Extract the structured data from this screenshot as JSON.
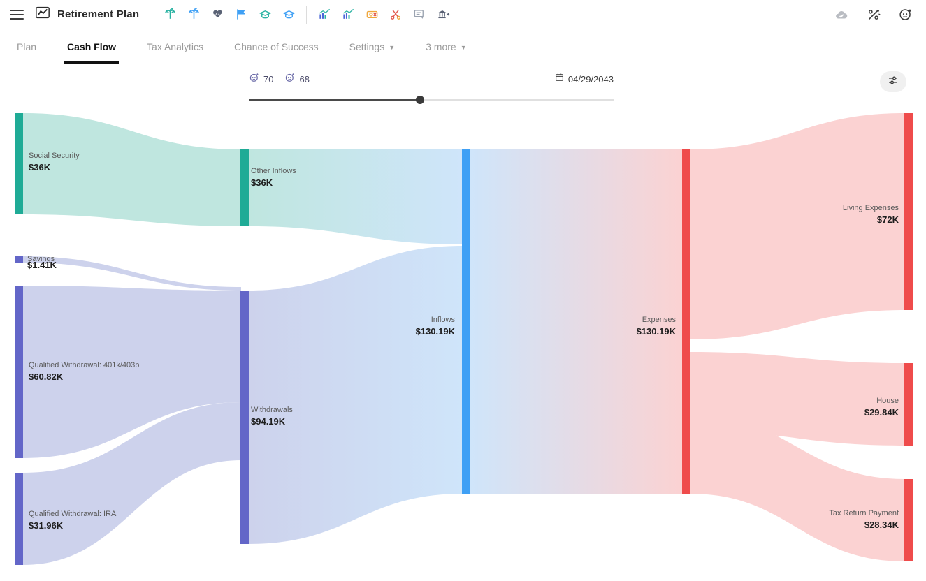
{
  "app": {
    "title": "Retirement Plan",
    "menu_icon": "hamburger-icon",
    "logo_icon": "chart-line-icon"
  },
  "toolbar": {
    "icons": [
      {
        "name": "palm-tree-teal-icon",
        "label": "Retirement"
      },
      {
        "name": "palm-tree-blue-icon",
        "label": "Retirement Spouse"
      },
      {
        "name": "heartbeat-icon",
        "label": "Health"
      },
      {
        "name": "flag-icon",
        "label": "Goal"
      },
      {
        "name": "graduation-cap-teal-icon",
        "label": "Education"
      },
      {
        "name": "graduation-cap-blue-icon",
        "label": "Education Spouse"
      },
      {
        "name": "bar-chart-up-blue-icon",
        "label": "Income"
      },
      {
        "name": "bar-chart-up-green-icon",
        "label": "Savings"
      },
      {
        "name": "money-x-icon",
        "label": "Expense"
      },
      {
        "name": "scissors-icon",
        "label": "Cut Expense"
      },
      {
        "name": "insurance-icon",
        "label": "Insurance"
      },
      {
        "name": "bank-transfer-icon",
        "label": "Transfer"
      }
    ],
    "right_icons": [
      {
        "name": "cloud-saved-icon",
        "label": "Saved"
      },
      {
        "name": "percent-slash-icon",
        "label": "Assumptions"
      },
      {
        "name": "add-person-icon",
        "label": "Add Client"
      }
    ]
  },
  "tabs": [
    {
      "label": "Plan",
      "active": false,
      "dropdown": false
    },
    {
      "label": "Cash Flow",
      "active": true,
      "dropdown": false
    },
    {
      "label": "Tax Analytics",
      "active": false,
      "dropdown": false
    },
    {
      "label": "Chance of Success",
      "active": false,
      "dropdown": false
    },
    {
      "label": "Settings",
      "active": false,
      "dropdown": true
    },
    {
      "label": "3 more",
      "active": false,
      "dropdown": true
    }
  ],
  "timeline": {
    "age_primary": "70",
    "age_secondary": "68",
    "date": "04/29/2043",
    "slider_percent": "47",
    "person_icon": "person-age-icon",
    "calendar_icon": "calendar-icon"
  },
  "settings_button": {
    "name": "chart-settings-button",
    "icon": "sliders-icon"
  },
  "chart_data": {
    "type": "sankey",
    "title": "Cash Flow",
    "currency": "USD",
    "nodes": [
      {
        "id": "social_security",
        "label": "Social Security",
        "value": "$36K",
        "amount": 36000,
        "color": "#1fab96",
        "column": 0
      },
      {
        "id": "savings",
        "label": "Savings",
        "value": "$1.41K",
        "amount": 1410,
        "color": "#6366c8",
        "column": 0
      },
      {
        "id": "qw_401k",
        "label": "Qualified Withdrawal: 401k/403b",
        "value": "$60.82K",
        "amount": 60820,
        "color": "#6366c8",
        "column": 0
      },
      {
        "id": "qw_ira",
        "label": "Qualified Withdrawal: IRA",
        "value": "$31.96K",
        "amount": 31960,
        "color": "#6366c8",
        "column": 0
      },
      {
        "id": "other_inflows",
        "label": "Other Inflows",
        "value": "$36K",
        "amount": 36000,
        "color": "#1fab96",
        "column": 1
      },
      {
        "id": "withdrawals",
        "label": "Withdrawals",
        "value": "$94.19K",
        "amount": 94190,
        "color": "#6366c8",
        "column": 1
      },
      {
        "id": "inflows",
        "label": "Inflows",
        "value": "$130.19K",
        "amount": 130190,
        "color": "#3fa0f5",
        "column": 2
      },
      {
        "id": "expenses",
        "label": "Expenses",
        "value": "$130.19K",
        "amount": 130190,
        "color": "#ef4b4b",
        "column": 3
      },
      {
        "id": "living_expenses",
        "label": "Living Expenses",
        "value": "$72K",
        "amount": 72000,
        "color": "#ef4b4b",
        "column": 4
      },
      {
        "id": "house",
        "label": "House",
        "value": "$29.84K",
        "amount": 29840,
        "color": "#ef4b4b",
        "column": 4
      },
      {
        "id": "tax_return_payment",
        "label": "Tax Return Payment",
        "value": "$28.34K",
        "amount": 28340,
        "color": "#ef4b4b",
        "column": 4
      }
    ],
    "links": [
      {
        "source": "social_security",
        "target": "other_inflows",
        "value": 36000
      },
      {
        "source": "savings",
        "target": "withdrawals",
        "value": 1410
      },
      {
        "source": "qw_401k",
        "target": "withdrawals",
        "value": 60820
      },
      {
        "source": "qw_ira",
        "target": "withdrawals",
        "value": 31960
      },
      {
        "source": "other_inflows",
        "target": "inflows",
        "value": 36000
      },
      {
        "source": "withdrawals",
        "target": "inflows",
        "value": 94190
      },
      {
        "source": "inflows",
        "target": "expenses",
        "value": 130190
      },
      {
        "source": "expenses",
        "target": "living_expenses",
        "value": 72000
      },
      {
        "source": "expenses",
        "target": "house",
        "value": 29840
      },
      {
        "source": "expenses",
        "target": "tax_return_payment",
        "value": 28340
      }
    ],
    "palette": {
      "teal": "#1fab96",
      "teal_flow": "#bfe6df",
      "purple": "#6366c8",
      "purple_flow": "#cdd2ec",
      "blue": "#3fa0f5",
      "blue_flow": "#cfe5fa",
      "red": "#ef4b4b",
      "red_flow": "#fbd2d2"
    }
  }
}
